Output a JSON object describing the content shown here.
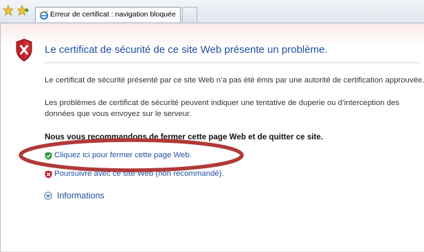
{
  "browser": {
    "tab_title": "Erreur de certificat : navigation bloquée",
    "icons": [
      "favorites-star-icon",
      "add-favorites-icon",
      "ie-icon"
    ]
  },
  "page": {
    "title": "Le certificat de sécurité de ce site Web présente un problème.",
    "paragraph1": "Le certificat de sécurité présenté par ce site Web n’a pas été émis par une autorité de certification approuvée.",
    "paragraph2_line1": "Les problèmes de certificat de sécurité peuvent indiquer une tentative de duperie ou d’interception des",
    "paragraph2_line2": "données que vous envoyez sur le serveur.",
    "recommendation": "Nous vous recommandons de fermer cette page Web et de quitter ce site.",
    "close_link": "Cliquez ici pour fermer cette page Web.",
    "continue_link": "Poursuivre avec ce site Web (non recommandé).",
    "info_label": "Informations"
  },
  "colors": {
    "link": "#1f4fa0",
    "error_red": "#c0202a",
    "annotation": "#b03a38",
    "ok_green": "#2f9a3c"
  }
}
